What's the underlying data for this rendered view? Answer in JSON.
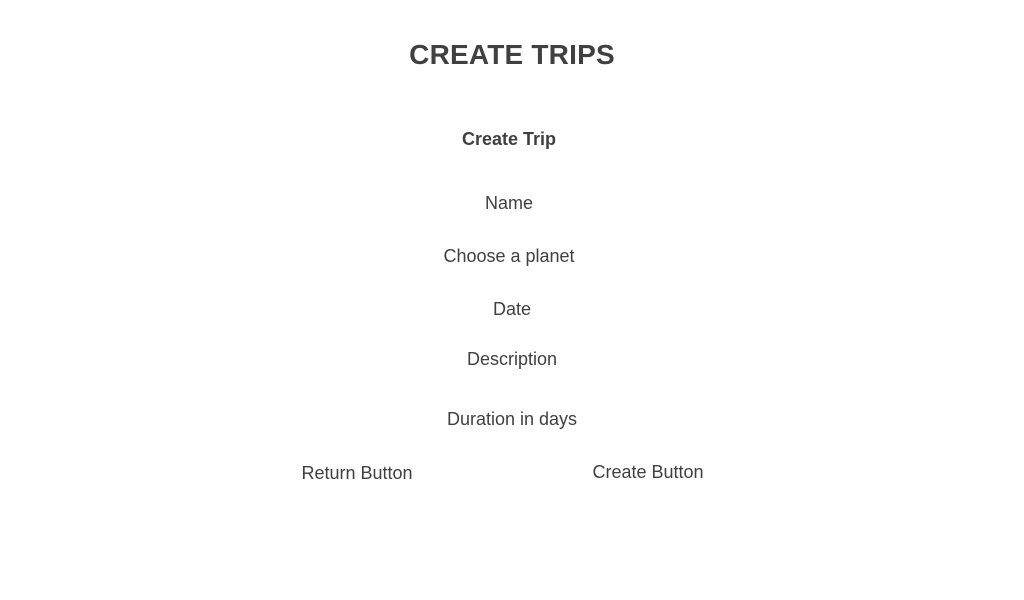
{
  "page": {
    "title": "CREATE TRIPS"
  },
  "form": {
    "title": "Create Trip",
    "fields": {
      "name_label": "Name",
      "planet_label": "Choose a planet",
      "date_label": "Date",
      "description_label": "Description",
      "duration_label": "Duration in days"
    },
    "buttons": {
      "return_label": "Return Button",
      "create_label": "Create Button"
    }
  }
}
